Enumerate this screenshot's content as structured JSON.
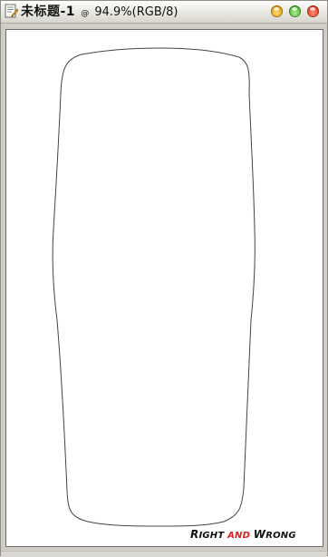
{
  "window": {
    "title_name": "未标题-1",
    "title_at": "@",
    "title_zoom": "94.9%(RGB/8)"
  },
  "icons": {
    "document": "document-icon",
    "minimize": "minimize-icon",
    "maximize": "maximize-icon",
    "close": "close-icon"
  },
  "colors": {
    "minimize": "#e69a16",
    "maximize": "#4bb82e",
    "close": "#e23a20",
    "watermark_accent": "#d82020"
  },
  "watermark": {
    "word1_initial": "R",
    "word1_rest": "IGHT",
    "word2": "AND",
    "word3_initial": "W",
    "word3_rest": "RONG"
  }
}
